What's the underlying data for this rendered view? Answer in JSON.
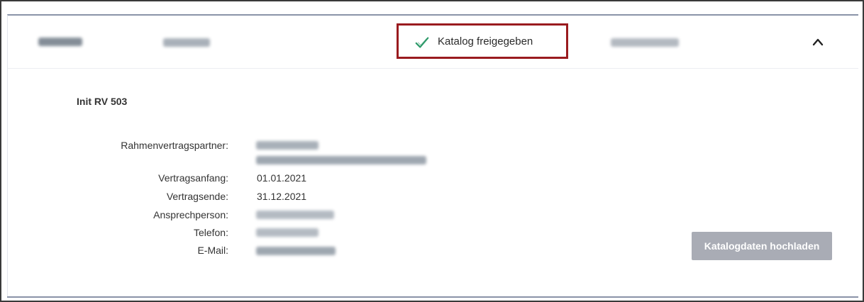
{
  "header": {
    "status_label": "Katalog freigegeben"
  },
  "details": {
    "section_title": "Init RV 503",
    "fields": {
      "partner_label": "Rahmenvertragspartner:",
      "start_label": "Vertragsanfang:",
      "start_value": "01.01.2021",
      "end_label": "Vertragsende:",
      "end_value": "31.12.2021",
      "contact_label": "Ansprechperson:",
      "phone_label": "Telefon:",
      "email_label": "E-Mail:"
    }
  },
  "actions": {
    "upload_label": "Katalogdaten hochladen"
  },
  "colors": {
    "highlight_border": "#9a1b1f",
    "check_icon": "#2e9a6a",
    "disabled_button": "#a9acb5",
    "card_border": "#8a93a8"
  },
  "icons": {
    "status": "check-icon",
    "toggle": "chevron-up-icon"
  }
}
